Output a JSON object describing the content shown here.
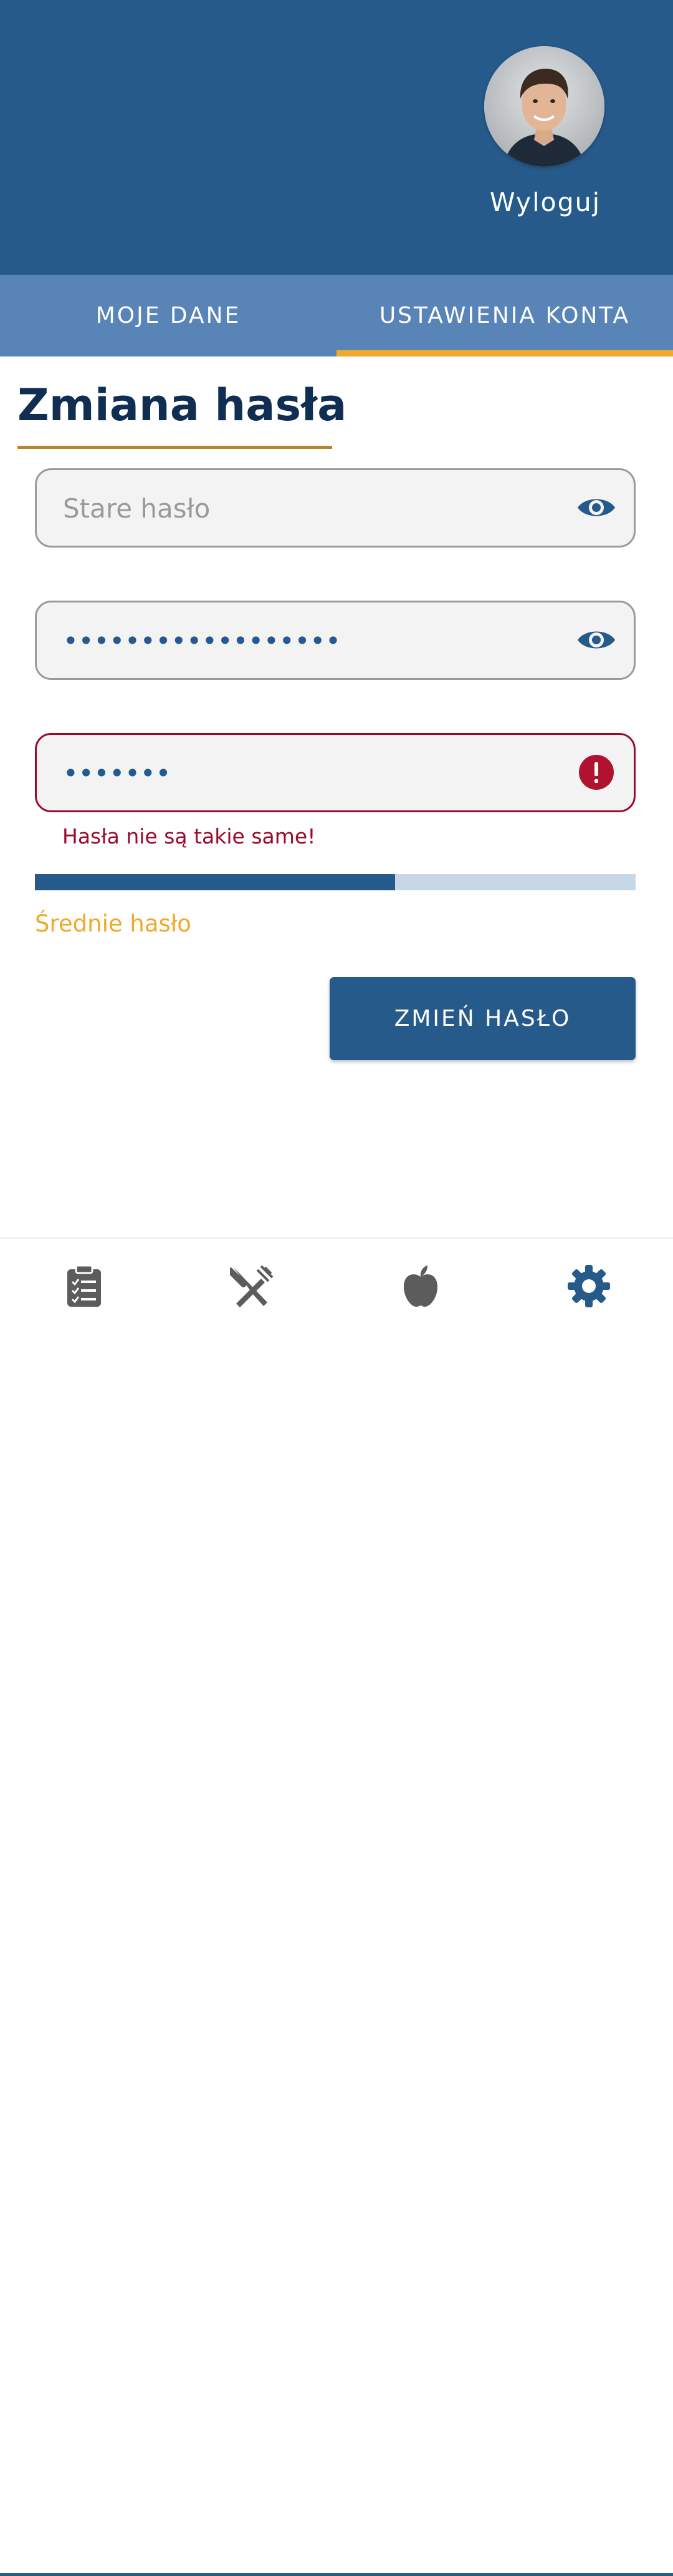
{
  "header": {
    "logout_label": "Wyloguj"
  },
  "tabs": [
    {
      "label": "MOJE DANE",
      "active": false
    },
    {
      "label": "USTAWIENIA KONTA",
      "active": true
    }
  ],
  "page": {
    "title": "Zmiana hasła"
  },
  "form": {
    "old_password": {
      "value": "",
      "placeholder": "Stare hasło"
    },
    "new_password": {
      "value": "••••••••••••••••••",
      "placeholder": ""
    },
    "confirm_password": {
      "value": "•••••••",
      "placeholder": ""
    },
    "error_message": "Hasła nie są takie same!",
    "strength_fraction": 0.6,
    "strength_label": "Średnie hasło",
    "submit_label": "ZMIEŃ HASŁO"
  },
  "bottom_nav": [
    {
      "icon": "clipboard-checklist-icon",
      "active": false
    },
    {
      "icon": "fork-knife-icon",
      "active": false
    },
    {
      "icon": "apple-icon",
      "active": false
    },
    {
      "icon": "gear-icon",
      "active": true
    }
  ],
  "colors": {
    "primary": "#255a8b",
    "tab_bar": "#5984b7",
    "accent": "#f0a92a",
    "error": "#9c0a2b",
    "title": "#102d52"
  }
}
